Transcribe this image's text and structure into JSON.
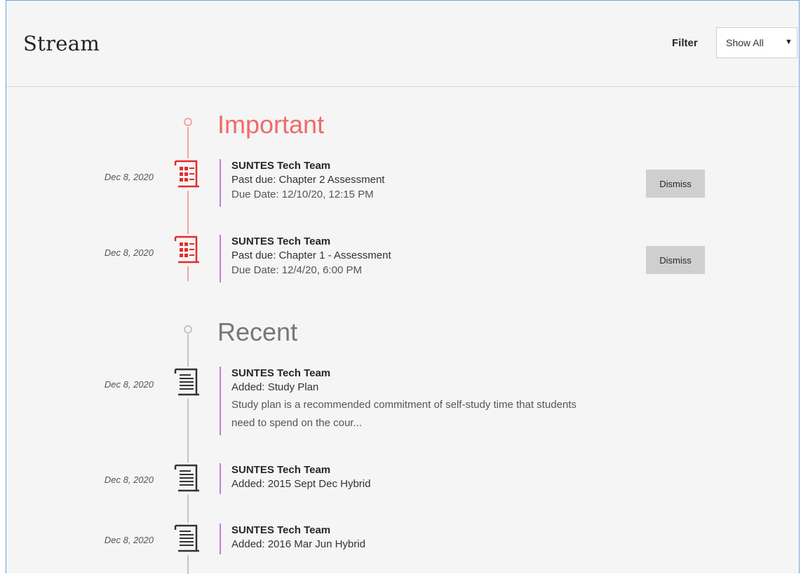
{
  "header": {
    "title": "Stream",
    "filter_label": "Filter",
    "filter_value": "Show All"
  },
  "colors": {
    "important": "#f06a6a",
    "recent": "#777777",
    "accent_bar": "#c67ad8",
    "important_icon": "#e22d2d",
    "recent_icon": "#333333"
  },
  "sections": {
    "important": {
      "title": "Important",
      "items": [
        {
          "date": "Dec 8, 2020",
          "author": "SUNTES Tech Team",
          "title": "Past due: Chapter 2 Assessment",
          "detail": "Due Date: 12/10/20, 12:15 PM",
          "dismiss": "Dismiss",
          "icon": "assessment-icon"
        },
        {
          "date": "Dec 8, 2020",
          "author": "SUNTES Tech Team",
          "title": "Past due: Chapter 1 - Assessment",
          "detail": "Due Date: 12/4/20, 6:00 PM",
          "dismiss": "Dismiss",
          "icon": "assessment-icon"
        }
      ]
    },
    "recent": {
      "title": "Recent",
      "items": [
        {
          "date": "Dec 8, 2020",
          "author": "SUNTES Tech Team",
          "title": "Added: Study Plan",
          "detail_line1": "Study plan is a recommended commitment of self-study time that students",
          "detail_line2": "need to spend on the cour...",
          "icon": "document-icon"
        },
        {
          "date": "Dec 8, 2020",
          "author": "SUNTES Tech Team",
          "title": "Added: 2015 Sept Dec Hybrid",
          "icon": "document-icon"
        },
        {
          "date": "Dec 8, 2020",
          "author": "SUNTES Tech Team",
          "title": "Added: 2016 Mar Jun Hybrid",
          "icon": "document-icon"
        }
      ]
    }
  }
}
